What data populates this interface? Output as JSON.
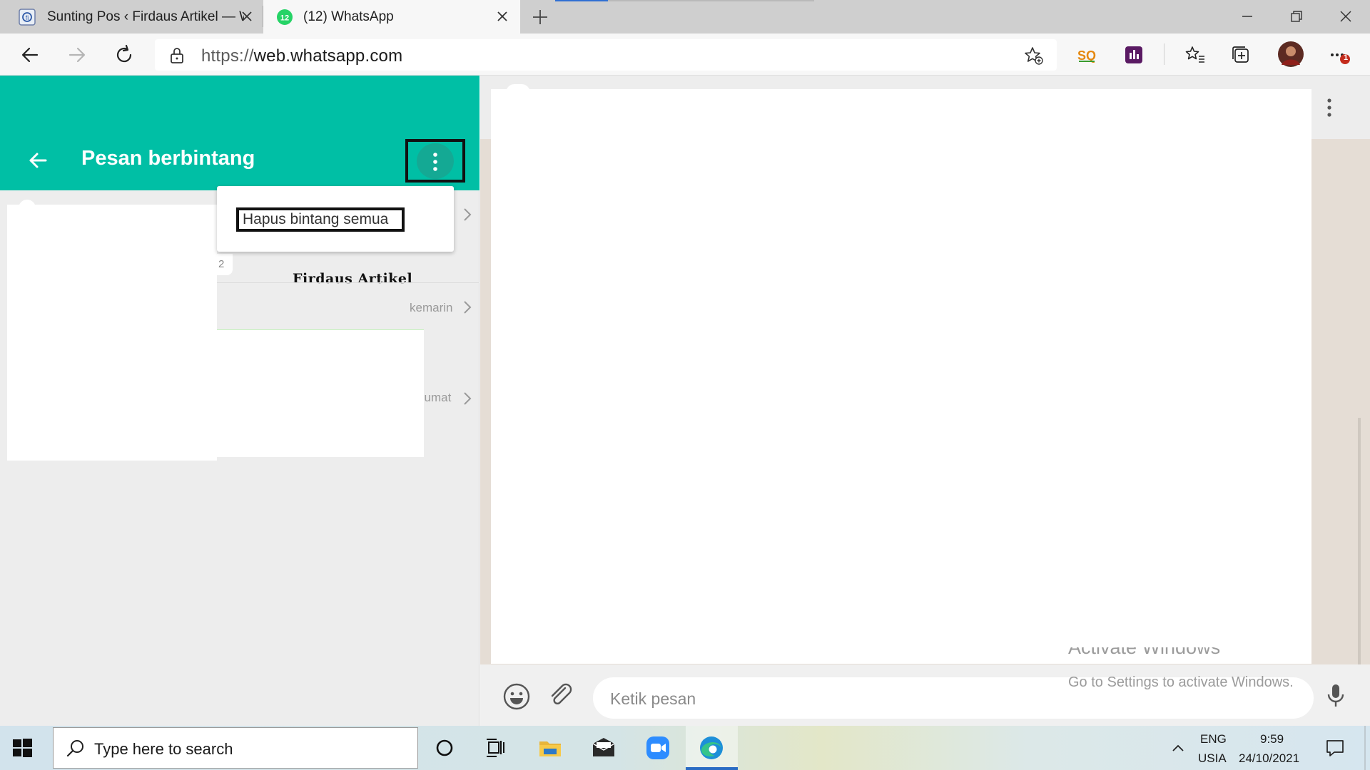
{
  "browser": {
    "tabs": [
      {
        "title": "Sunting Pos ‹ Firdaus Artikel — W",
        "active": false
      },
      {
        "title": "(12) WhatsApp",
        "active": true,
        "badge": "12"
      }
    ],
    "url_scheme": "https://",
    "url_host": "web.whatsapp.com",
    "notification_badge": "1"
  },
  "whatsapp": {
    "left_header_title": "Pesan berbintang",
    "menu_item": "Hapus bintang semua",
    "badge_count": "2",
    "watermark_label": "Firdaus Artikel",
    "meta_1": "kemarin",
    "meta_2": "Jumat",
    "compose_placeholder": "Ketik pesan",
    "brand_color": "#00bfa5"
  },
  "windows": {
    "activate_title": "Activate Windows",
    "activate_subtitle": "Go to Settings to activate Windows.",
    "search_placeholder": "Type here to search",
    "lang_top": "ENG",
    "lang_bottom": "USIA",
    "time": "9:59",
    "date": "24/10/2021"
  }
}
